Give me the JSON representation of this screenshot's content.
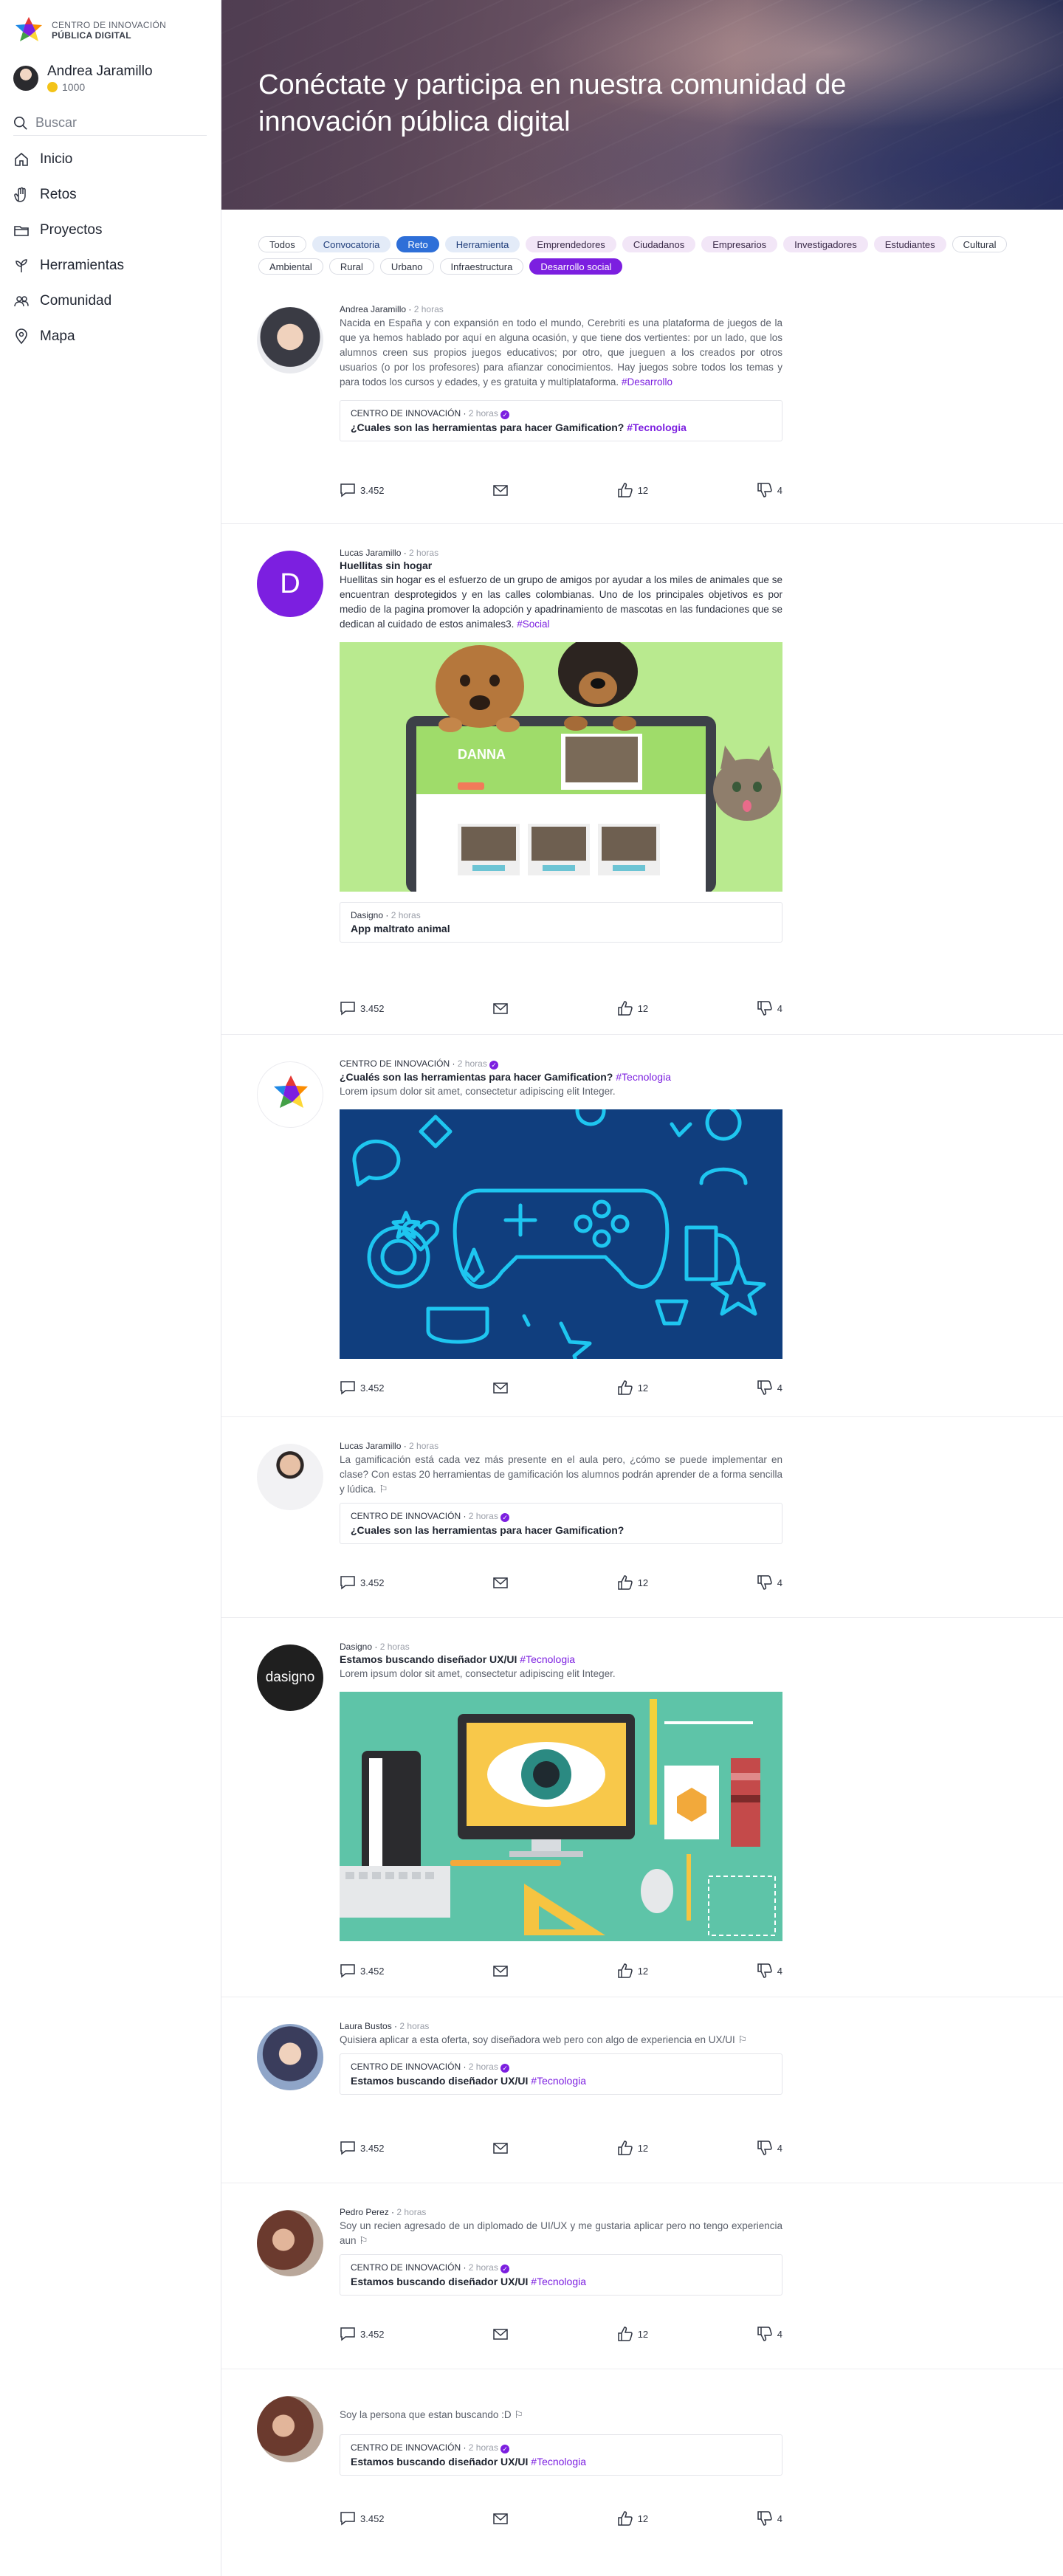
{
  "brand": {
    "line1": "CENTRO DE INNOVACIÓN",
    "line2": "PÚBLICA DIGITAL"
  },
  "user": {
    "name": "Andrea Jaramillo",
    "points": "1000"
  },
  "search": {
    "placeholder": "Buscar"
  },
  "nav": [
    {
      "label": "Inicio",
      "icon": "home-icon"
    },
    {
      "label": "Retos",
      "icon": "hand-icon"
    },
    {
      "label": "Proyectos",
      "icon": "folder-icon"
    },
    {
      "label": "Herramientas",
      "icon": "plant-icon"
    },
    {
      "label": "Comunidad",
      "icon": "people-icon"
    },
    {
      "label": "Mapa",
      "icon": "map-pin-icon"
    }
  ],
  "hero": {
    "title": "Conéctate y participa en nuestra comunidad de innovación pública digital"
  },
  "filters": [
    {
      "label": "Todos",
      "style": "plain"
    },
    {
      "label": "Convocatoria",
      "style": "blue"
    },
    {
      "label": "Reto",
      "style": "blue-active"
    },
    {
      "label": "Herramienta",
      "style": "blue"
    },
    {
      "label": "Emprendedores",
      "style": "purple"
    },
    {
      "label": "Ciudadanos",
      "style": "purple"
    },
    {
      "label": "Empresarios",
      "style": "purple"
    },
    {
      "label": "Investigadores",
      "style": "purple"
    },
    {
      "label": "Estudiantes",
      "style": "purple"
    },
    {
      "label": "Cultural",
      "style": "plain"
    },
    {
      "label": "Ambiental",
      "style": "plain"
    },
    {
      "label": "Rural",
      "style": "plain"
    },
    {
      "label": "Urbano",
      "style": "plain"
    },
    {
      "label": "Infraestructura",
      "style": "plain"
    },
    {
      "label": "Desarrollo social",
      "style": "purple-active"
    }
  ],
  "colors": {
    "accent": "#7c1fe0",
    "primary_blue": "#2e6fd8",
    "coin": "#f3c318"
  },
  "actions": {
    "comments": "3.452",
    "likes": "12",
    "dislikes": "4"
  },
  "posts": [
    {
      "author": "Andrea Jaramillo",
      "time": "2 horas",
      "title": "",
      "text": "Nacida en España y con expansión en todo el mundo, Cerebriti es una plataforma de juegos de la que ya hemos hablado por aquí en alguna ocasión, y que tiene dos vertientes: por un lado, que los alumnos creen sus propios juegos educativos; por otro, que jueguen a los creados por otros usuarios (o por los profesores) para afianzar conocimientos. Hay juegos sobre todos los temas y para todos los cursos y edades, y es gratuita y multiplataforma.",
      "tag": "#Desarrollo",
      "quote": {
        "author": "CENTRO DE INNOVACIÓN",
        "time": "2 horas",
        "title": "¿Cuales son las herramientas para hacer Gamification?",
        "tag": "#Tecnologia"
      }
    },
    {
      "author": "Lucas Jaramillo",
      "time": "2 horas",
      "title": "Huellitas sin hogar",
      "text": "Huellitas sin hogar es el esfuerzo de un grupo de amigos por ayudar a los miles de animales que se encuentran desprotegidos y en las calles colombianas. Uno de los principales objetivos es por medio de la pagina promover la adopción y apadrinamiento de mascotas en las fundaciones que se dedican al cuidado de estos animales3.",
      "tag": "#Social",
      "avatar_letter": "D",
      "image_caption": "DANNA",
      "quote": {
        "author": "Dasigno",
        "time": "2 horas",
        "title": "App maltrato animal",
        "tag": ""
      }
    },
    {
      "author": "CENTRO DE INNOVACIÓN",
      "time": "2 horas",
      "title": "¿Cualés son las herramientas para hacer Gamification?",
      "title_tag": "#Tecnologia",
      "text": "Lorem ipsum dolor sit amet, consectetur adipiscing elit Integer."
    },
    {
      "author": "Lucas Jaramillo",
      "time": "2 horas",
      "title": "",
      "text": "La gamificación está cada vez más presente en el aula pero, ¿cómo se puede implementar en clase? Con estas 20 herramientas de gamificación los alumnos podrán aprender de a forma sencilla y lúdica.",
      "quote": {
        "author": "CENTRO DE INNOVACIÓN",
        "time": "2 horas",
        "title": "¿Cuales son las herramientas para hacer Gamification?",
        "tag": ""
      }
    },
    {
      "author": "Dasigno",
      "time": "2 horas",
      "title": "Estamos buscando diseñador UX/UI",
      "title_tag": "#Tecnologia",
      "text": "Lorem ipsum dolor sit amet, consectetur adipiscing elit Integer.",
      "avatar_text": "dasigno"
    },
    {
      "author": "Laura Bustos",
      "time": "2 horas",
      "title": "",
      "text": "Quisiera aplicar a esta oferta, soy diseñadora web pero con algo de experiencia en UX/UI",
      "quote": {
        "author": "CENTRO DE INNOVACIÓN",
        "time": "2 horas",
        "title": "Estamos buscando diseñador UX/UI",
        "tag": "#Tecnologia"
      }
    },
    {
      "author": "Pedro Perez",
      "time": "2 horas",
      "title": "",
      "text": "Soy un recien agresado de un diplomado de UI/UX y me gustaria aplicar pero no tengo experiencia aun",
      "quote": {
        "author": "CENTRO DE INNOVACIÓN",
        "time": "2 horas",
        "title": "Estamos buscando diseñador UX/UI",
        "tag": "#Tecnologia"
      }
    },
    {
      "author": "",
      "time": "",
      "title": "",
      "text": "Soy la persona que estan buscando :D",
      "quote": {
        "author": "CENTRO DE INNOVACIÓN",
        "time": "2 horas",
        "title": "Estamos buscando diseñador UX/UI",
        "tag": "#Tecnologia"
      }
    }
  ]
}
